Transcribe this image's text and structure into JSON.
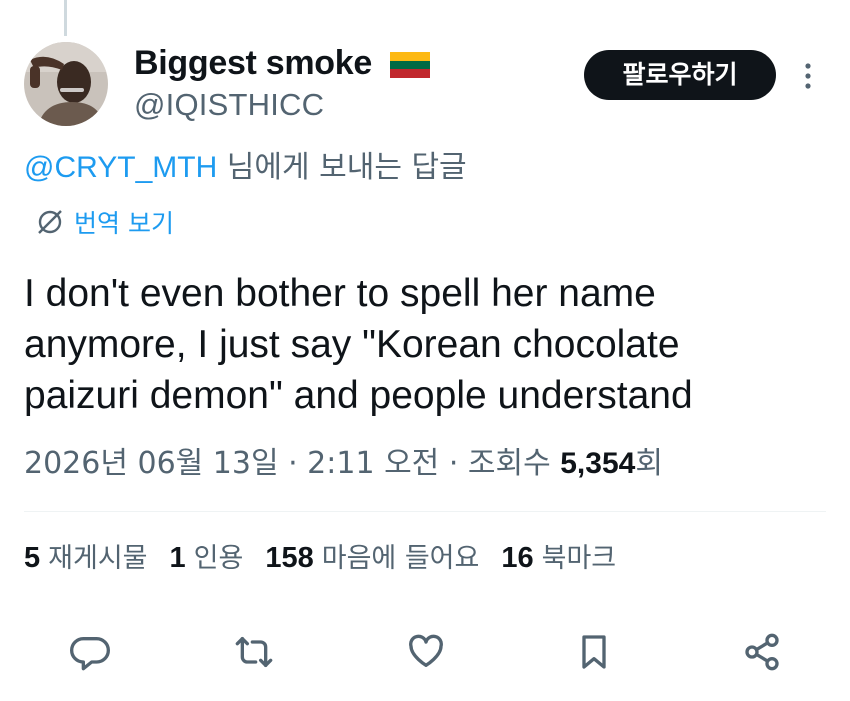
{
  "author": {
    "display_name": "Biggest smoke",
    "flag_icon": "lithuania-flag-icon",
    "handle": "@IQISTHICC"
  },
  "follow_label": "팔로우하기",
  "reply_to": {
    "mention": "@CRYT_MTH",
    "suffix": " 님에게 보내는 답글"
  },
  "translate_label": "번역 보기",
  "tweet": {
    "lines": [
      "I don't even bother to spell her name",
      "anymore, I just say \"Korean chocolate",
      "paizuri demon\" and people understand"
    ]
  },
  "meta": {
    "datetime": "2026년 06월 13일 · 2:11 오전 · 조회수 ",
    "views": "5,354",
    "views_suffix": "회"
  },
  "stats": [
    {
      "count": "5",
      "label": "재게시물"
    },
    {
      "count": "1",
      "label": "인용"
    },
    {
      "count": "158",
      "label": "마음에 들어요"
    },
    {
      "count": "16",
      "label": "북마크"
    }
  ],
  "colors": {
    "link": "#1d9bf0",
    "secondary_text": "#536471",
    "primary_text": "#0f1419",
    "follow_button_bg": "#0f1419",
    "flag_yellow": "#fdb913",
    "flag_green": "#006a44",
    "flag_red": "#c1272d"
  },
  "actions": [
    "reply-icon",
    "repost-icon",
    "like-icon",
    "bookmark-icon",
    "share-icon"
  ]
}
